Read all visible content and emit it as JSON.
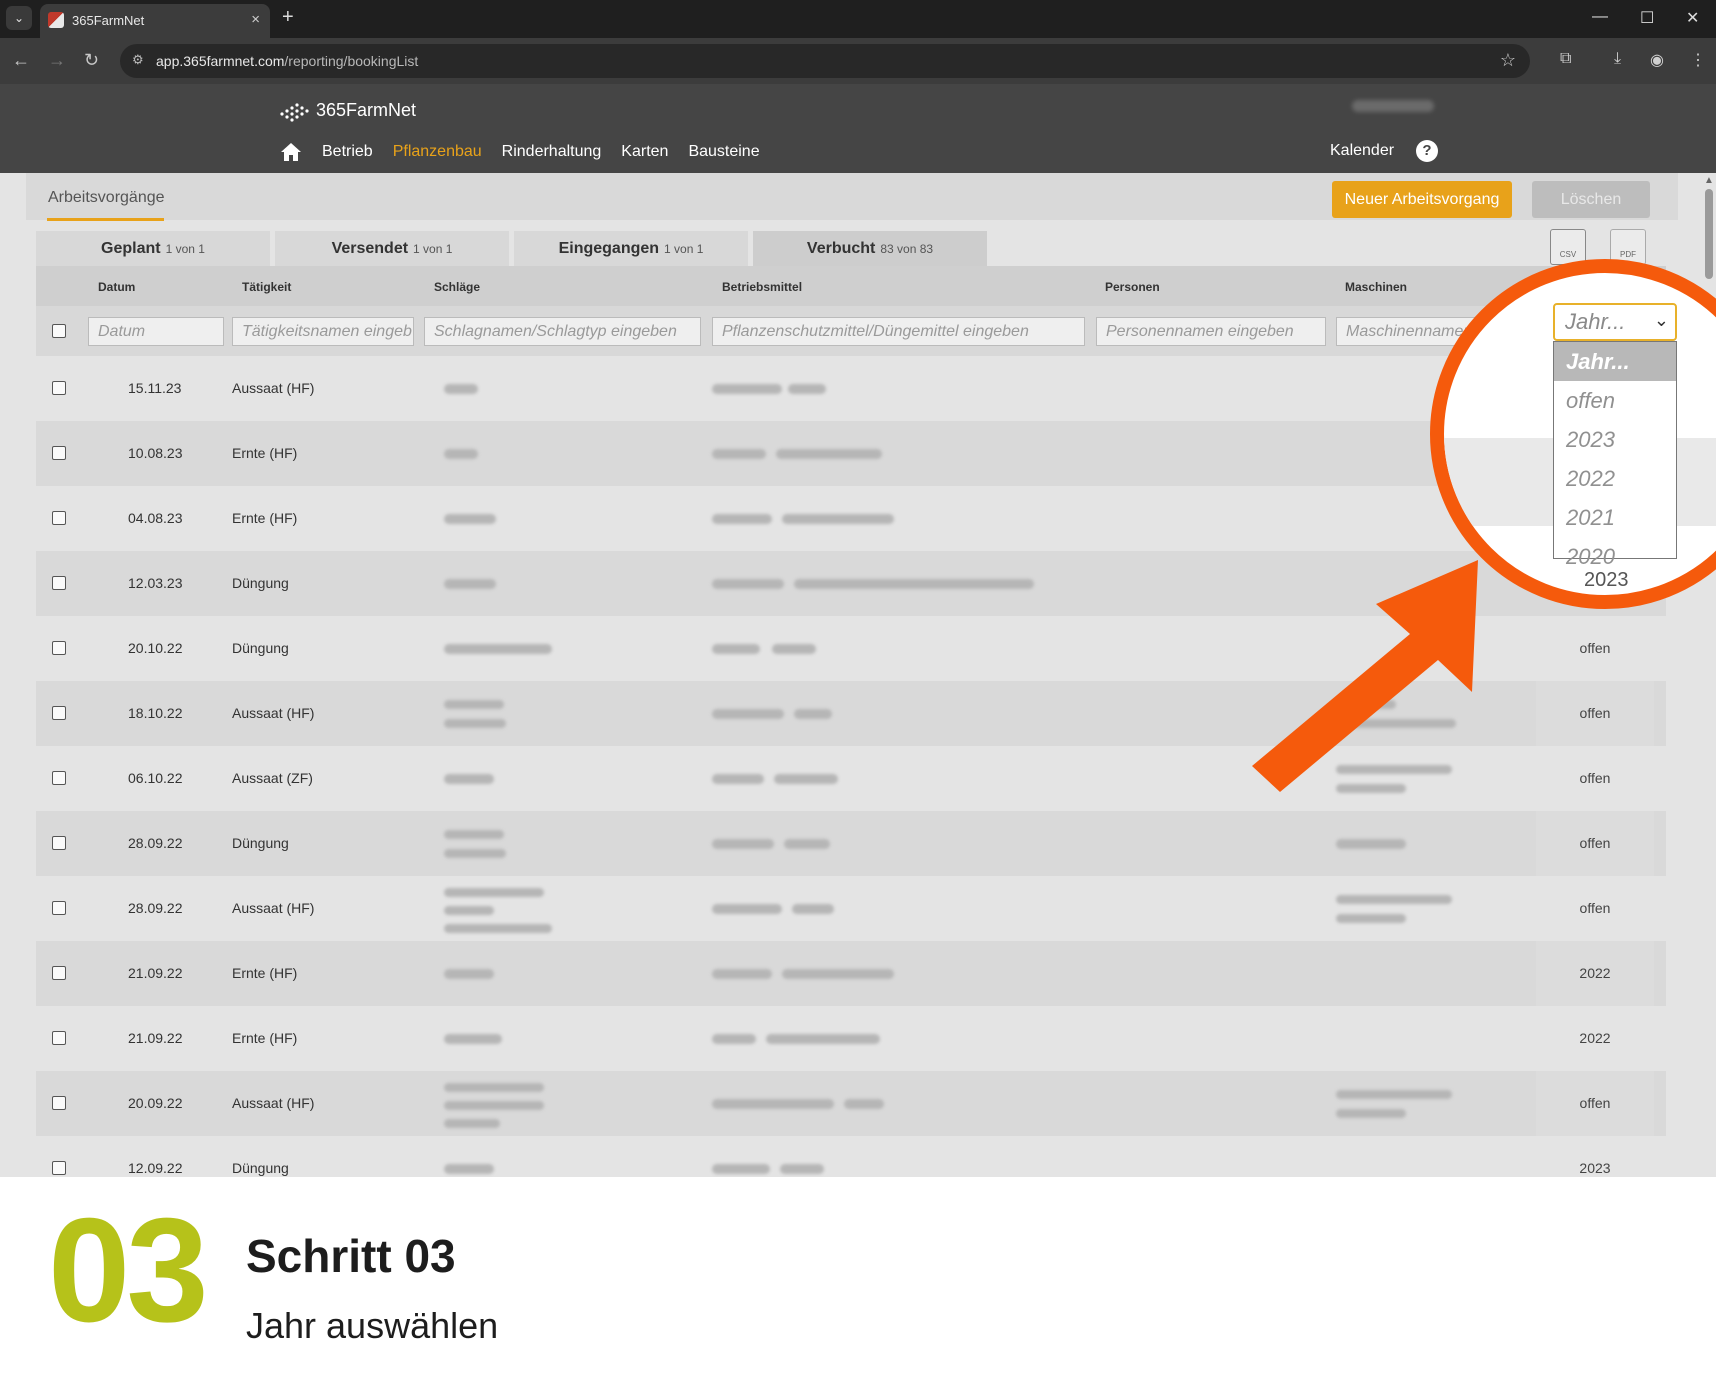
{
  "browser": {
    "tab_title": "365FarmNet",
    "tab_close": "×",
    "new_tab": "+",
    "url_domain": "app.365farmnet.com",
    "url_path": "/reporting/bookingList",
    "min": "—",
    "max": "☐",
    "close": "✕",
    "back": "←",
    "forward": "→",
    "reload": "↻",
    "star": "☆",
    "extensions": "⧉",
    "download": "⤓",
    "profile": "◉",
    "menu": "⋮"
  },
  "app": {
    "logo_text": "365FarmNet",
    "nav": [
      "Betrieb",
      "Pflanzenbau",
      "Rinderhaltung",
      "Karten",
      "Bausteine"
    ],
    "active_nav": "Pflanzenbau",
    "calendar": "Kalender",
    "help": "?"
  },
  "page": {
    "breadcrumb": "Arbeitsvorgänge",
    "new_button": "Neuer Arbeitsvorgang",
    "delete_button": "Löschen",
    "csv_label": "CSV",
    "pdf_label": "PDF",
    "tabs": [
      {
        "label": "Geplant",
        "count": "1 von 1"
      },
      {
        "label": "Versendet",
        "count": "1 von 1"
      },
      {
        "label": "Eingegangen",
        "count": "1 von 1"
      },
      {
        "label": "Verbucht",
        "count": "83 von 83"
      }
    ],
    "columns": [
      "Datum",
      "Tätigkeit",
      "Schläge",
      "Betriebsmittel",
      "Personen",
      "Maschinen"
    ],
    "filters": {
      "datum": "Datum",
      "taetigkeit": "Tätigkeitsnamen eingeb",
      "schlaege": "Schlagnamen/Schlagtyp eingeben",
      "betriebsmittel": "Pflanzenschutzmittel/Düngemittel eingeben",
      "personen": "Personennamen eingeben",
      "maschinen": "Maschinennamen eingeben"
    },
    "rows": [
      {
        "date": "15.11.23",
        "activity": "Aussaat (HF)",
        "status": ""
      },
      {
        "date": "10.08.23",
        "activity": "Ernte (HF)",
        "status": ""
      },
      {
        "date": "04.08.23",
        "activity": "Ernte (HF)",
        "status": ""
      },
      {
        "date": "12.03.23",
        "activity": "Düngung",
        "status": ""
      },
      {
        "date": "20.10.22",
        "activity": "Düngung",
        "status": "offen"
      },
      {
        "date": "18.10.22",
        "activity": "Aussaat (HF)",
        "status": "offen"
      },
      {
        "date": "06.10.22",
        "activity": "Aussaat (ZF)",
        "status": "offen"
      },
      {
        "date": "28.09.22",
        "activity": "Düngung",
        "status": "offen"
      },
      {
        "date": "28.09.22",
        "activity": "Aussaat (HF)",
        "status": "offen"
      },
      {
        "date": "21.09.22",
        "activity": "Ernte (HF)",
        "status": "2022"
      },
      {
        "date": "21.09.22",
        "activity": "Ernte (HF)",
        "status": "2022"
      },
      {
        "date": "20.09.22",
        "activity": "Aussaat (HF)",
        "status": "offen"
      },
      {
        "date": "12.09.22",
        "activity": "Düngung",
        "status": "2023"
      }
    ]
  },
  "year_select": {
    "selected": "Jahr...",
    "options": [
      "Jahr...",
      "offen",
      "2023",
      "2022",
      "2021",
      "2020"
    ],
    "below_value": "2023"
  },
  "footer": {
    "step_number": "03",
    "step_title": "Schritt 03",
    "step_subtitle": "Jahr auswählen"
  },
  "colors": {
    "accent": "#e8a21a",
    "highlight_circle": "#f55a0c",
    "step_number": "#b6c21a"
  }
}
